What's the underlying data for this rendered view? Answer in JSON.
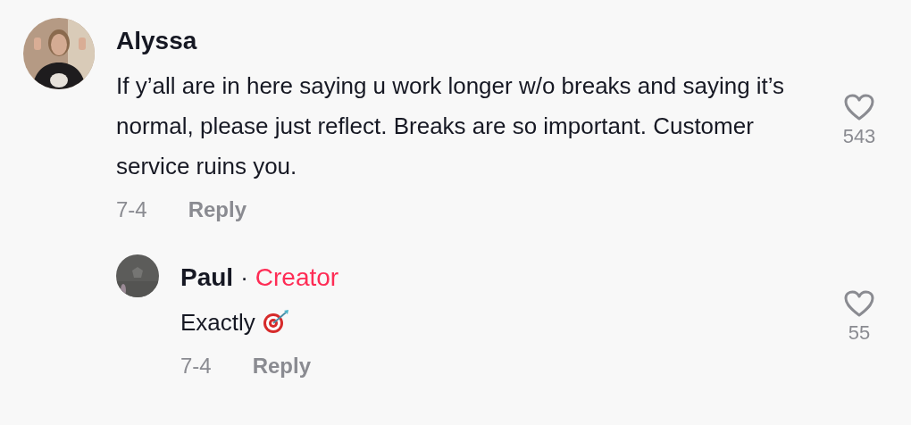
{
  "comments": [
    {
      "author": "Alyssa",
      "text": "If y’all are in here saying u work longer w/o breaks and saying it’s normal, please just reflect. Breaks are so important. Customer service ruins you.",
      "date": "7-4",
      "reply_label": "Reply",
      "likes": "543",
      "liked": false,
      "replies": [
        {
          "author": "Paul",
          "separator": "·",
          "badge": "Creator",
          "text": "Exactly",
          "date": "7-4",
          "reply_label": "Reply",
          "likes": "55",
          "liked": false
        }
      ]
    }
  ]
}
